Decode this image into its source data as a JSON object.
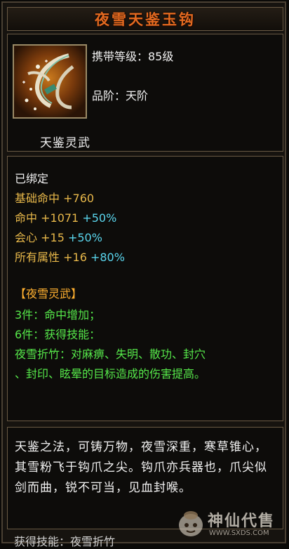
{
  "item": {
    "title": "夜雪天鉴玉钩",
    "level_line": "携带等级：85级",
    "grade_line": "品阶：天阶",
    "subtitle": "天鉴灵武"
  },
  "stats": {
    "bound": "已绑定",
    "base_hit_label": "基础命中",
    "base_hit_value": "+760",
    "hit_label": "命中",
    "hit_value": "+1071",
    "hit_bonus": "+50%",
    "crit_label": "会心",
    "crit_value": "+15",
    "crit_bonus": "+50%",
    "all_attr_label": "所有属性",
    "all_attr_value": "+16",
    "all_attr_bonus": "+80%"
  },
  "set": {
    "name": "【夜雪灵武】",
    "piece3": "3件：命中增加；",
    "piece6": "6件：获得技能：",
    "skill_line1": "夜雪折竹：对麻痹、失明、散功、封穴",
    "skill_line2": "、封印、眩晕的目标造成的伤害提高。"
  },
  "lore": {
    "text": "天鉴之法，可铸万物，夜雪深重，寒草锥心，其雪粉飞于钩爪之尖。钩爪亦兵器也，爪尖似剑而曲，锐不可当，见血封喉。"
  },
  "footer": {
    "cutoff_text": "获得技能：夜雪折竹"
  },
  "watermark": {
    "brand": "神仙代售",
    "url": "WWW.SXDS.COM"
  },
  "colors": {
    "title": "#e46a20",
    "gold": "#e8b84a",
    "green": "#56e84a",
    "blue": "#5ad6ee",
    "border": "#6a5a44"
  }
}
